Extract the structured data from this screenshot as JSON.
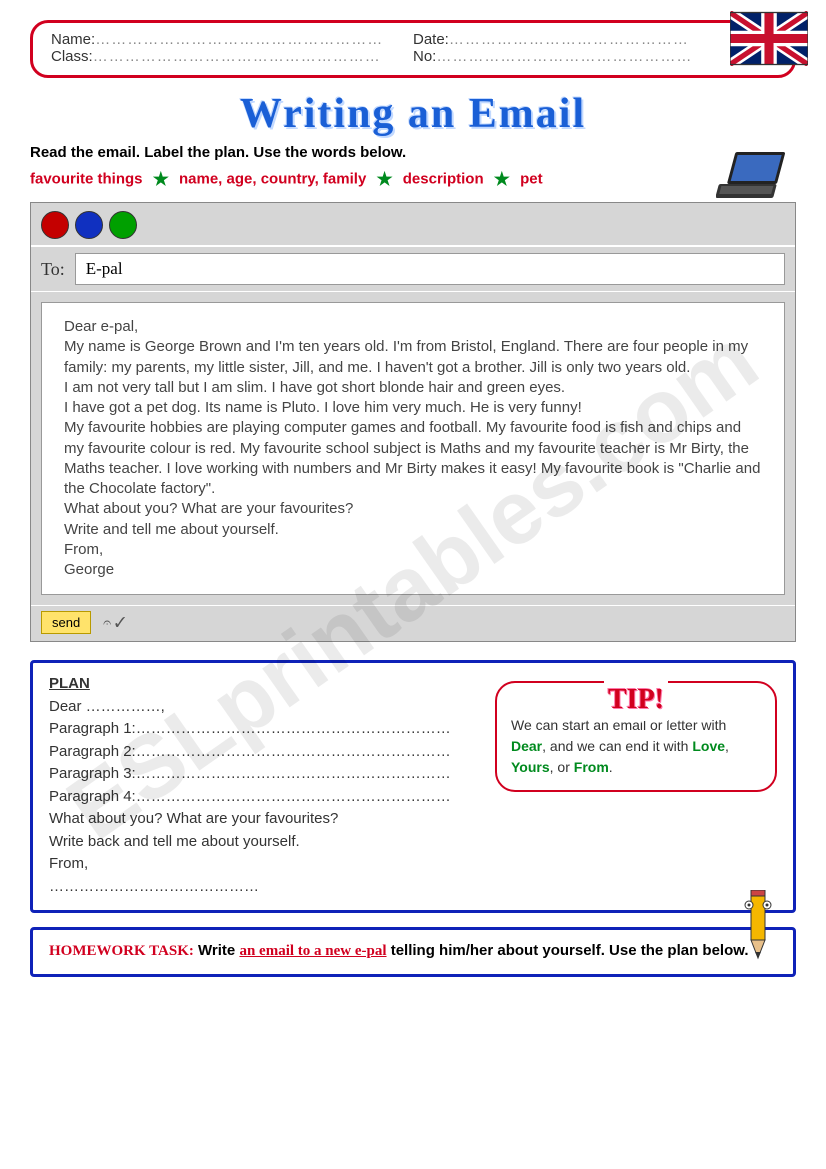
{
  "header": {
    "name_label": "Name:",
    "date_label": "Date:",
    "class_label": "Class:",
    "no_label": "No:"
  },
  "title": "Writing an Email",
  "instruction": "Read the email. Label the plan. Use the words below.",
  "words": {
    "w1": "favourite things",
    "w2": "name, age, country, family",
    "w3": "description",
    "w4": "pet"
  },
  "email": {
    "to_label": "To:",
    "to_value": "E-pal",
    "greeting": "Dear e-pal,",
    "p1": "My name is George Brown and I'm ten years old. I'm from Bristol, England. There are four people in my family: my parents, my little sister, Jill, and me. I haven't got a brother. Jill is only two years old.",
    "p2": "I am not very tall but I am slim. I have got short blonde hair and green eyes.",
    "p3": "I have got a pet dog. Its name is Pluto. I love him very much. He is very funny!",
    "p4": "My favourite hobbies are playing computer games and football. My favourite food is fish and chips and my favourite colour is red. My favourite school subject is Maths and my favourite teacher is Mr Birty, the Maths teacher. I love working with numbers and Mr Birty makes it easy! My favourite book is \"Charlie and the Chocolate factory\".",
    "q1": "What about you? What are your favourites?",
    "q2": "Write and tell me about yourself.",
    "signoff": "From,",
    "sender": "George",
    "send_label": "send"
  },
  "plan": {
    "title": "PLAN",
    "dear": "Dear ……………,",
    "p1": "Paragraph 1:………………………………………………………",
    "p2": "Paragraph 2:………………………………………………………",
    "p3": "Paragraph 3:………………………………………………………",
    "p4": "Paragraph 4:………………………………………………………",
    "q": "What about you? What are your favourites?",
    "w": "Write back and tell me about yourself.",
    "from": "From,",
    "blank": "……………………………………"
  },
  "tip": {
    "label": "TIP!",
    "text_pre": "We can start an email or letter with ",
    "dear": "Dear",
    "text_mid": ", and we can end it with ",
    "love": "Love",
    "yours": "Yours",
    "from": "From",
    "or": ", or ",
    "comma": ", ",
    "period": "."
  },
  "homework": {
    "label": "HOMEWORK TASK:",
    "pre": " Write ",
    "underlined": "an email to a new e-pal",
    "post": " telling him/her about yourself. Use the plan below."
  },
  "watermark": "ESLprintables.com"
}
